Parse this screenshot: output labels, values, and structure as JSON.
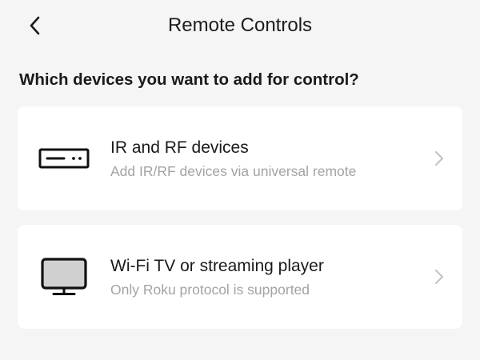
{
  "header": {
    "title": "Remote Controls",
    "back_icon": "chevron-left-icon"
  },
  "question": "Which devices you want to add for control?",
  "options": [
    {
      "icon": "ir-rf-device-icon",
      "title": "IR and RF devices",
      "subtitle": "Add IR/RF devices via universal remote",
      "chevron_icon": "chevron-right-icon"
    },
    {
      "icon": "tv-monitor-icon",
      "title": "Wi-Fi TV or streaming player",
      "subtitle": "Only Roku protocol is supported",
      "chevron_icon": "chevron-right-icon"
    }
  ],
  "colors": {
    "background": "#f5f5f5",
    "card": "#ffffff",
    "text_primary": "#1a1a1a",
    "text_secondary": "#a3a3a3",
    "chevron": "#c4c4c4"
  }
}
